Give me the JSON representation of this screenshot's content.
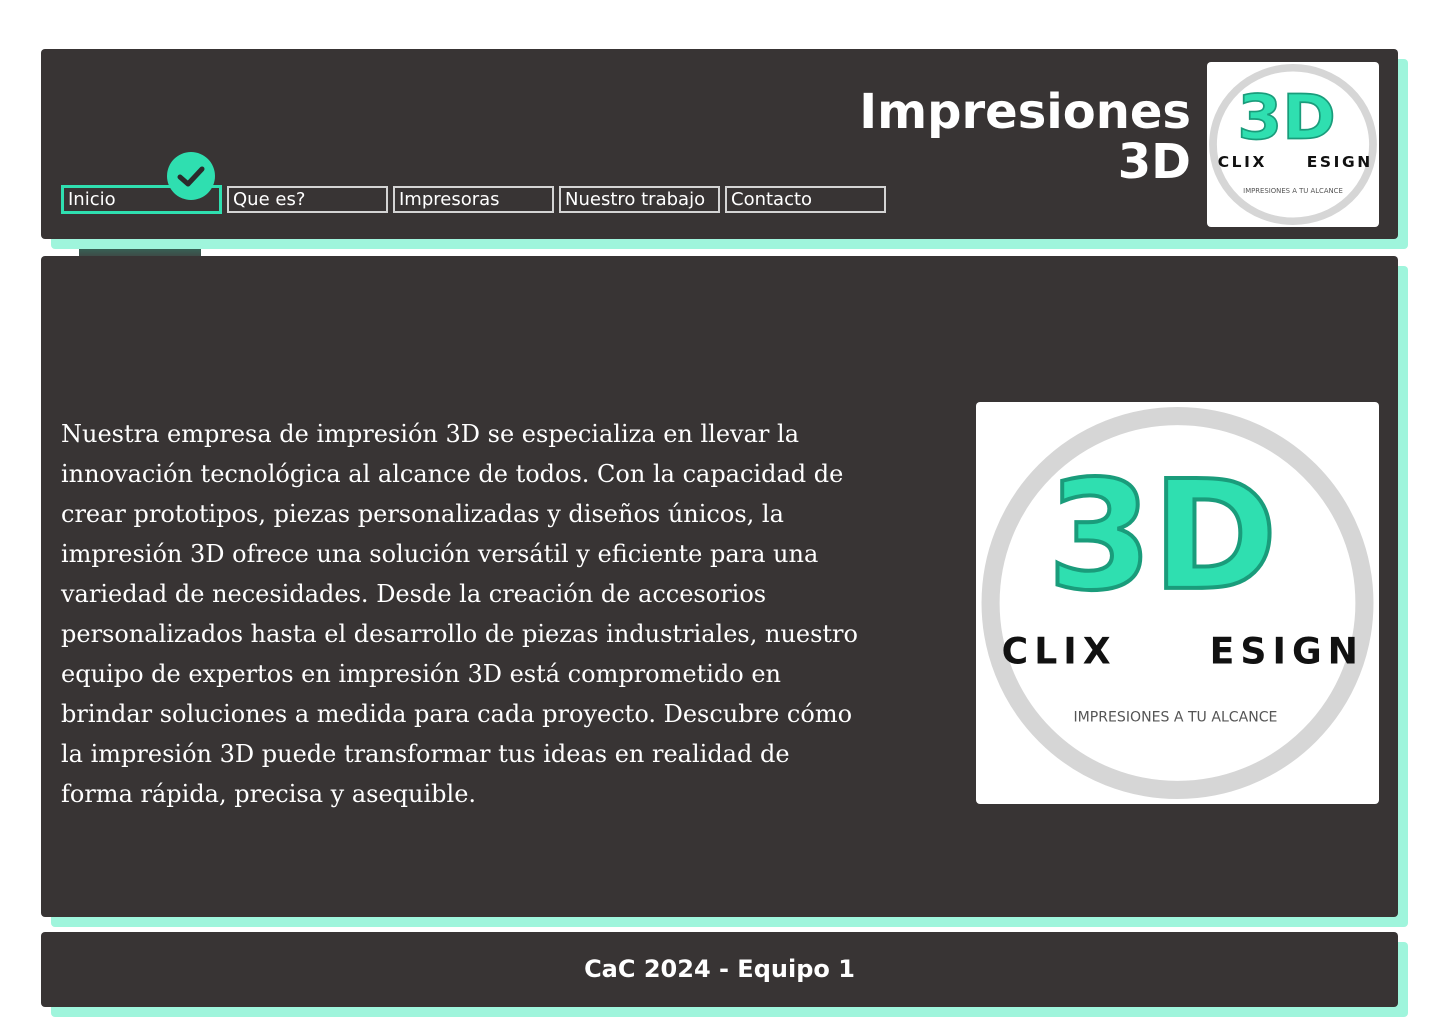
{
  "header": {
    "title_line1": "Impresiones",
    "title_line2": "3D"
  },
  "nav": {
    "items": [
      {
        "label": "Inicio",
        "active": true
      },
      {
        "label": "Que es?",
        "active": false
      },
      {
        "label": "Impresoras",
        "active": false
      },
      {
        "label": "Nuestro trabajo",
        "active": false
      },
      {
        "label": "Contacto",
        "active": false
      }
    ]
  },
  "logo": {
    "mark": "3D",
    "word_left": "CLIX",
    "word_right": "ESIGN",
    "tagline": "Impresiones a tu alcance"
  },
  "main": {
    "intro": "Nuestra empresa de impresión 3D se especializa en llevar la innovación tecnológica al alcance de todos. Con la capacidad de crear prototipos, piezas personalizadas y diseños únicos, la impresión 3D ofrece una solución versátil y eficiente para una variedad de necesidades. Desde la creación de accesorios personalizados hasta el desarrollo de piezas industriales, nuestro equipo de expertos en impresión 3D está comprometido en brindar soluciones a medida para cada proyecto. Descubre cómo la impresión 3D puede transformar tus ideas en realidad de forma rápida, precisa y asequible."
  },
  "footer": {
    "text": "CaC 2024 - Equipo 1"
  },
  "colors": {
    "panel": "#383434",
    "accent": "#2fdfb0",
    "shadow": "#9ff5dc",
    "logo_ring": "#d6d6d6"
  },
  "icons": [
    "checkmark-icon"
  ]
}
